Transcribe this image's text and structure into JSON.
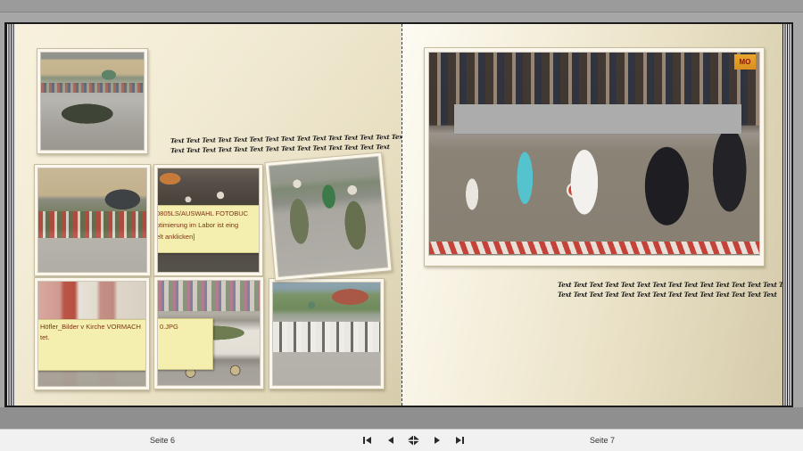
{
  "window": {
    "left_page_label": "Seite 6",
    "right_page_label": "Seite 7"
  },
  "text_blocks": {
    "left": {
      "line1": "Text Text Text Text Text Text Text Text Text Text Text Text Text Text Text",
      "line2": "Text Text Text Text Text Text Text Text Text Text Text Text Text Text"
    },
    "right": {
      "line1": "Text Text Text Text Text Text Text Text Text Text Text Text Text Text Text",
      "line2": "Text Text Text Text Text Text Text Text Text Text Text Text Text Text"
    }
  },
  "sticky_notes": {
    "fotobuch_note": {
      "line1": "0805LS/AUSWAHL FOTOBUC",
      "line2": "ptimierung im Labor ist eing",
      "line3": "elt anklicken]"
    },
    "kirche_note": {
      "line1": "Höfler_Bilder v Kirche VORMACH",
      "line2": "tet."
    },
    "jpg_note": {
      "line1": "0.JPG"
    }
  },
  "photo_overlays": {
    "shop_sign": "MO"
  },
  "navigation": {
    "first_icon": "go-first-page",
    "previous_icon": "go-previous-page",
    "overview_icon": "fit-spread-overview",
    "next_icon": "go-next-page",
    "last_icon": "go-last-page"
  },
  "colors": {
    "page_cream": "#EFE7CE",
    "outer_gray": "#9B9B9B",
    "censor_bar": "#ACACAC",
    "note_yellow": "#F4EFAF",
    "note_text": "#7C3214"
  }
}
